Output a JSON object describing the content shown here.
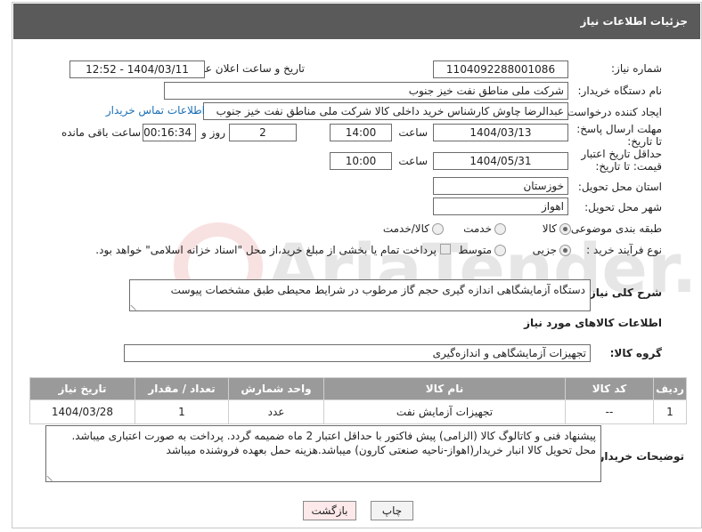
{
  "header": {
    "title": "جزئیات اطلاعات نیاز"
  },
  "fields": {
    "need_number": {
      "label": "شماره نیاز:",
      "value": "1104092288001086"
    },
    "announce": {
      "label": "تاریخ و ساعت اعلان عمومی:",
      "value": "1404/03/11 - 12:52"
    },
    "buyer": {
      "label": "نام دستگاه خریدار:",
      "value": "شرکت ملی مناطق نفت خیز جنوب"
    },
    "creator": {
      "label": "ایجاد کننده درخواست:",
      "value": "عبدالرضا چاوش  کارشناس خرید داخلی کالا شرکت ملی مناطق نفت خیز جنوب",
      "contact_link": "اطلاعات تماس خریدار"
    },
    "deadline": {
      "label": "مهلت ارسال پاسخ: تا تاریخ:",
      "date": "1404/03/13",
      "time_label": "ساعت",
      "time": "14:00",
      "days": "2",
      "days_label": "روز و",
      "remaining": "00:16:34",
      "remaining_label": "ساعت باقی مانده"
    },
    "validity": {
      "label": "حداقل تاریخ اعتبار قیمت: تا تاریخ:",
      "date": "1404/05/31",
      "time_label": "ساعت",
      "time": "10:00"
    },
    "province": {
      "label": "استان محل تحویل:",
      "value": "خوزستان"
    },
    "city": {
      "label": "شهر محل تحویل:",
      "value": "اهواز"
    },
    "category": {
      "label": "طبقه بندی موضوعی:",
      "options": [
        "کالا",
        "خدمت",
        "کالا/خدمت"
      ],
      "selected": "کالا"
    },
    "process": {
      "label": "نوع فرآیند خرید :",
      "options": [
        "جزیی",
        "متوسط"
      ],
      "selected": "جزیی",
      "note": "پرداخت تمام یا بخشی از مبلغ خرید،از محل \"اسناد خزانه اسلامی\" خواهد بود."
    }
  },
  "summary": {
    "label": "شرح کلی نیاز:",
    "value": "دستگاه آزمایشگاهی اندازه گیری حجم گاز مرطوب در شرایط محیطی طبق مشخصات پیوست"
  },
  "goods_title": "اطلاعات کالاهای مورد نیاز",
  "goods_group": {
    "label": "گروه کالا:",
    "value": "تجهیزات آزمایشگاهی و اندازه‌گیری"
  },
  "table": {
    "headers": [
      "ردیف",
      "کد کالا",
      "نام کالا",
      "واحد شمارش",
      "تعداد / مقدار",
      "تاریخ نیاز"
    ],
    "rows": [
      [
        "1",
        "--",
        "تجهیزات آزمایش نفت",
        "عدد",
        "1",
        "1404/03/28"
      ]
    ]
  },
  "notes": {
    "label": "توضیحات خریدار:",
    "value": "پیشنهاد فنی و کاتالوگ کالا (الزامی) پیش فاکتور با حداقل اعتبار 2 ماه ضمیمه گردد. پرداخت به صورت اعتباری میباشد. محل تحویل کالا انبار خریدار(اهواز-ناحیه صنعتی کارون) میباشد.هزینه حمل بعهده فروشنده میباشد"
  },
  "buttons": {
    "print": "چاپ",
    "back": "بازگشت"
  },
  "watermark": "AriaTender.net",
  "colors": {
    "header_bg": "#5a5a5a",
    "table_header_bg": "#9a9a9a",
    "link": "#1a6fb5",
    "back_button_bg": "#fde9e9"
  }
}
